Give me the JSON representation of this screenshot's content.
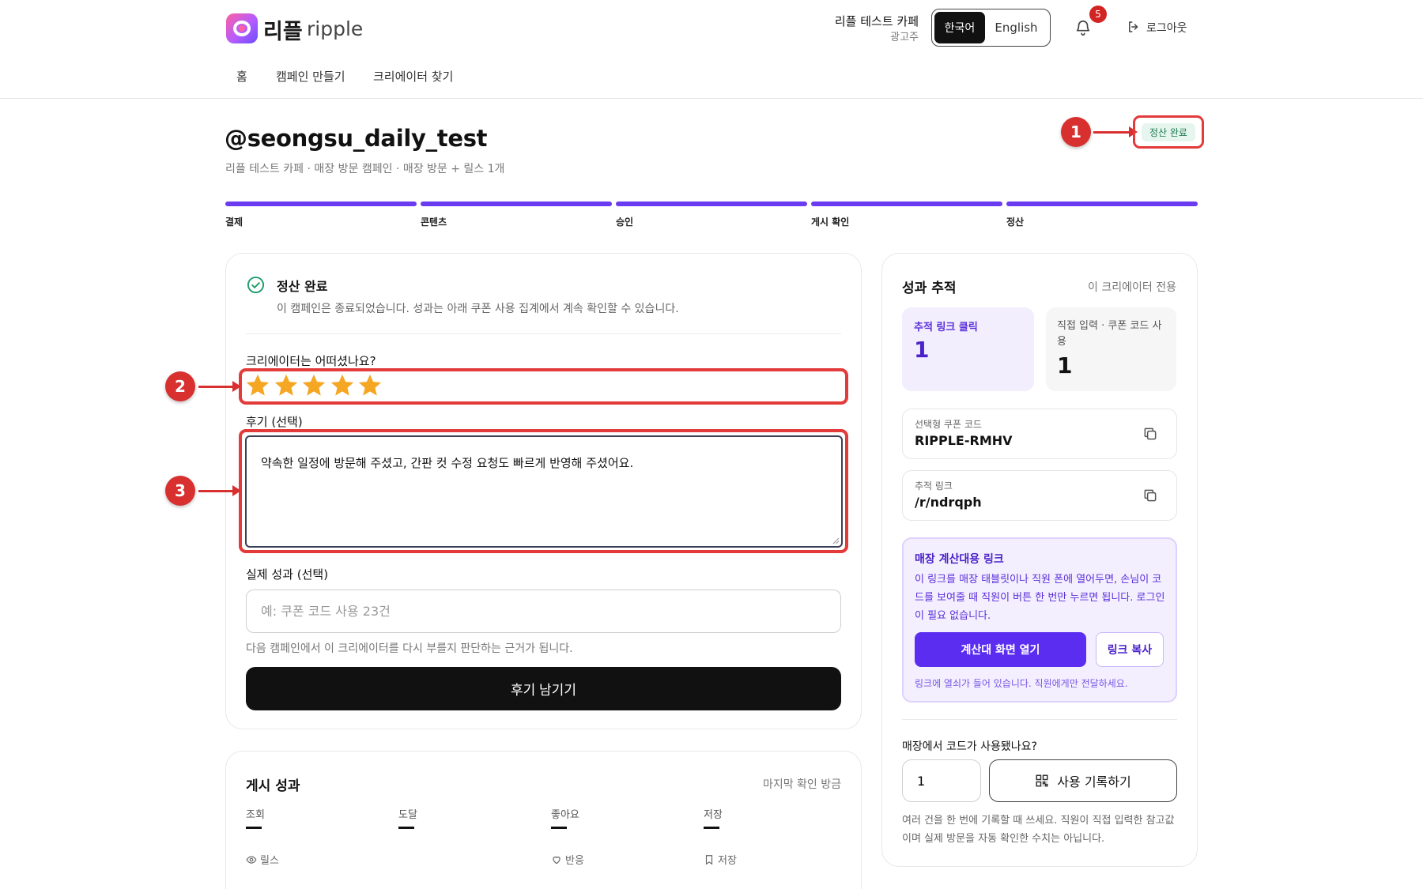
{
  "brand": {
    "name_ko": "리플",
    "name_en": "ripple"
  },
  "account": {
    "name": "리플 테스트 카페",
    "role": "광고주"
  },
  "language": {
    "ko": "한국어",
    "en": "English"
  },
  "notifications": {
    "count": "5"
  },
  "logout": {
    "label": "로그아웃"
  },
  "nav": {
    "home": "홈",
    "create": "캠페인 만들기",
    "find": "크리에이터 찾기"
  },
  "page": {
    "title": "@seongsu_daily_test",
    "subtitle": "리플 테스트 카페 · 매장 방문 캠페인 · 매장 방문 + 릴스 1개",
    "status": "정산 완료"
  },
  "callouts": {
    "c1": "1",
    "c2": "2",
    "c3": "3"
  },
  "steps": [
    {
      "label": "결제"
    },
    {
      "label": "콘텐츠"
    },
    {
      "label": "승인"
    },
    {
      "label": "게시 확인"
    },
    {
      "label": "정산"
    }
  ],
  "review": {
    "done_title": "정산 완료",
    "done_desc": "이 캠페인은 종료되었습니다. 성과는 아래 쿠폰 사용 집계에서 계속 확인할 수 있습니다.",
    "rating_question": "크리에이터는 어떠셨나요?",
    "rating": 5,
    "review_label": "후기 (선택)",
    "review_text": "약속한 일정에 방문해 주셨고, 간판 컷 수정 요청도 빠르게 반영해 주셨어요.",
    "perf_label": "실제 성과 (선택)",
    "perf_placeholder": "예: 쿠폰 코드 사용 23건",
    "perf_help": "다음 캠페인에서 이 크리에이터를 다시 부를지 판단하는 근거가 됩니다.",
    "submit": "후기 남기기"
  },
  "post_perf": {
    "title": "게시 성과",
    "meta": "마지막 확인 방금",
    "metrics": [
      {
        "label": "조회",
        "sub": "릴스"
      },
      {
        "label": "도달",
        "sub": ""
      },
      {
        "label": "좋아요",
        "sub": "반응"
      },
      {
        "label": "저장",
        "sub": "저장"
      }
    ]
  },
  "tracking": {
    "title": "성과 추적",
    "meta": "이 크리에이터 전용",
    "clicks_label": "추적 링크 클릭",
    "clicks_value": "1",
    "direct_label": "직접 입력 · 쿠폰 코드 사용",
    "direct_value": "1",
    "coupon_label": "선택형 쿠폰 코드",
    "coupon_value": "RIPPLE-RMHV",
    "link_label": "추적 링크",
    "link_value": "/r/ndrqph"
  },
  "pos": {
    "title": "매장 계산대용 링크",
    "desc": "이 링크를 매장 태블릿이나 직원 폰에 열어두면, 손님이 코드를 보여줄 때 직원이 버튼 한 번만 누르면 됩니다. 로그인이 필요 없습니다.",
    "open_btn": "계산대 화면 열기",
    "copy_btn": "링크 복사",
    "note": "링크에 열쇠가 들어 있습니다. 직원에게만 전달하세요."
  },
  "usage": {
    "question": "매장에서 코드가 사용됐나요?",
    "qty": "1",
    "record_btn": "사용 기록하기",
    "note": "여러 건을 한 번에 기록할 때 쓰세요. 직원이 직접 입력한 참고값이며 실제 방문을 자동 확인한 수치는 아닙니다."
  },
  "colors": {
    "accent": "#5b2df0",
    "highlight": "#e33a3a",
    "star": "#f5a623",
    "success": "#1e9c6a"
  }
}
